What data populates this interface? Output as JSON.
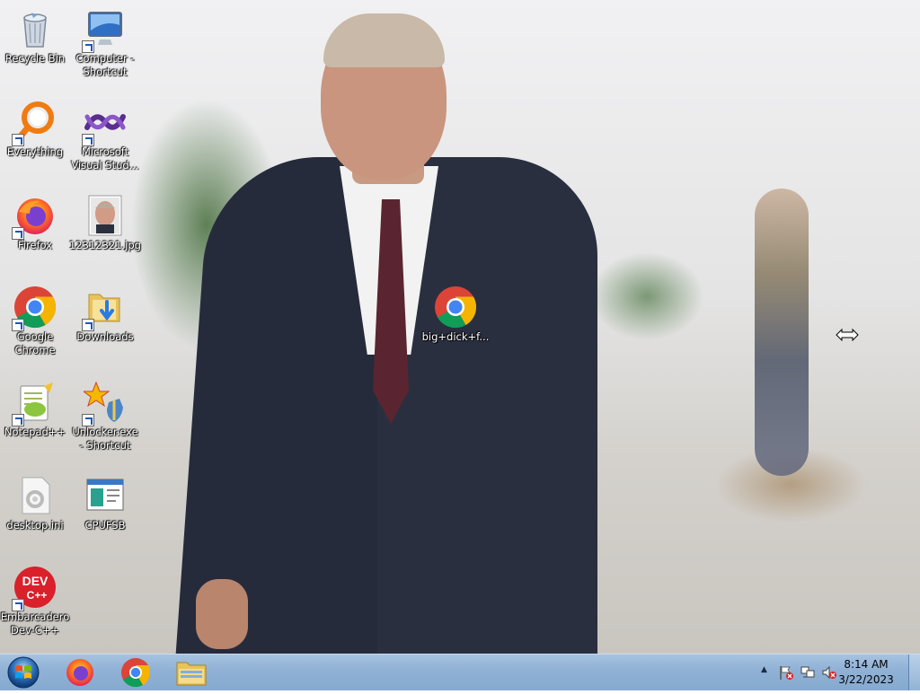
{
  "desktop": {
    "icons": [
      {
        "id": "recycle-bin",
        "label": "Recycle Bin",
        "icon": "recycle-bin-icon"
      },
      {
        "id": "computer-shortcut",
        "label": "Computer - Shortcut",
        "icon": "computer-icon"
      },
      {
        "id": "everything",
        "label": "Everything",
        "icon": "everything-icon"
      },
      {
        "id": "visual-studio",
        "label": "Microsoft Visual Stud...",
        "icon": "visual-studio-icon"
      },
      {
        "id": "firefox",
        "label": "Firefox",
        "icon": "firefox-icon"
      },
      {
        "id": "jpg-file",
        "label": "12312321.jpg",
        "icon": "image-file-icon"
      },
      {
        "id": "google-chrome",
        "label": "Google Chrome",
        "icon": "chrome-icon"
      },
      {
        "id": "downloads",
        "label": "Downloads",
        "icon": "downloads-folder-icon"
      },
      {
        "id": "notepad-plus-plus",
        "label": "Notepad++",
        "icon": "notepad-plus-plus-icon"
      },
      {
        "id": "unlocker",
        "label": "Unlocker.exe - Shortcut",
        "icon": "unlocker-icon"
      },
      {
        "id": "desktop-ini",
        "label": "desktop.ini",
        "icon": "settings-file-icon"
      },
      {
        "id": "cpufsb",
        "label": "CPUFSB",
        "icon": "cpufsb-icon"
      },
      {
        "id": "dev-cpp",
        "label": "Embarcadero Dev-C++",
        "icon": "dev-cpp-icon"
      },
      {
        "id": "chrome-html-file",
        "label": "big+dick+f...",
        "icon": "chrome-icon"
      }
    ],
    "dev_icon_text_top": "DEV",
    "dev_icon_text_bottom": "C++"
  },
  "taskbar": {
    "start": "start-orb-icon",
    "pinned": [
      "firefox-icon",
      "chrome-icon",
      "file-explorer-icon"
    ],
    "tray": {
      "show_hidden": "▲",
      "icons": [
        "action-center-flag-icon",
        "network-icon",
        "volume-muted-icon"
      ]
    },
    "clock": {
      "time": "8:14 AM",
      "date": "3/22/2023"
    }
  },
  "colors": {
    "taskbar": "#8fb1d5",
    "chrome_red": "#db4437",
    "chrome_green": "#0f9d58",
    "chrome_yellow": "#f4b400",
    "chrome_blue": "#4285f4"
  }
}
